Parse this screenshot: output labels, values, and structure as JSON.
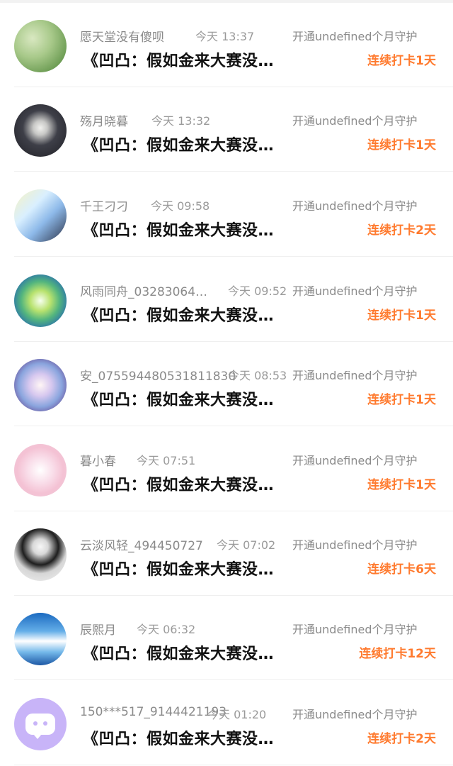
{
  "list": {
    "open_text": "开通undefined个月守护",
    "items": [
      {
        "name": "愿天堂没有傻呗",
        "time": "今天 13:37",
        "title": "《凹凸：假如金来大赛没…",
        "streak": "连续打卡1天",
        "avatar_icon": "avatar-image-icon"
      },
      {
        "name": "殇月晓暮",
        "time": "今天 13:32",
        "title": "《凹凸：假如金来大赛没…",
        "streak": "连续打卡1天",
        "avatar_icon": "avatar-image-icon"
      },
      {
        "name": "千王刁刁",
        "time": "今天 09:58",
        "title": "《凹凸：假如金来大赛没…",
        "streak": "连续打卡2天",
        "avatar_icon": "avatar-image-icon"
      },
      {
        "name": "风雨同舟_03283064…",
        "time": "今天 09:52",
        "title": "《凹凸：假如金来大赛没…",
        "streak": "连续打卡1天",
        "avatar_icon": "avatar-image-icon"
      },
      {
        "name": "安_07559448053181183​0",
        "time": "今天 08:53",
        "title": "《凹凸：假如金来大赛没…",
        "streak": "连续打卡1天",
        "avatar_icon": "avatar-image-icon"
      },
      {
        "name": "暮小春",
        "time": "今天 07:51",
        "title": "《凹凸：假如金来大赛没…",
        "streak": "连续打卡1天",
        "avatar_icon": "avatar-image-icon"
      },
      {
        "name": "云淡风轻_494450727",
        "time": "今天 07:02",
        "title": "《凹凸：假如金来大赛没…",
        "streak": "连续打卡6天",
        "avatar_icon": "avatar-image-icon"
      },
      {
        "name": "辰熙月",
        "time": "今天 06:32",
        "title": "《凹凸：假如金来大赛没…",
        "streak": "连续打卡12天",
        "avatar_icon": "avatar-image-icon"
      },
      {
        "name": "150***517_9144421193",
        "time": "今天 01:20",
        "title": "《凹凸：假如金来大赛没…",
        "streak": "连续打卡2天",
        "avatar_icon": "chat-bubble-icon"
      }
    ]
  },
  "colors": {
    "streak": "#ff7a2e",
    "name": "#8a8a8a",
    "title": "#111111",
    "divider": "#efefef"
  }
}
